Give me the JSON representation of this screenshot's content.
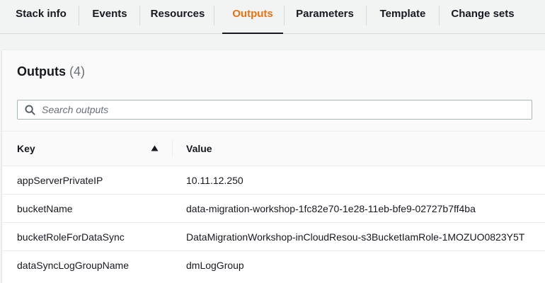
{
  "tabs": [
    {
      "label": "Stack info",
      "active": false
    },
    {
      "label": "Events",
      "active": false
    },
    {
      "label": "Resources",
      "active": false
    },
    {
      "label": "Outputs",
      "active": true
    },
    {
      "label": "Parameters",
      "active": false
    },
    {
      "label": "Template",
      "active": false
    },
    {
      "label": "Change sets",
      "active": false
    }
  ],
  "outputs": {
    "title": "Outputs",
    "count": "(4)",
    "search_placeholder": "Search outputs",
    "columns": {
      "key": "Key",
      "value": "Value"
    },
    "sort_icon": "caret-up-icon",
    "rows": [
      {
        "key": "appServerPrivateIP",
        "value": "10.11.12.250"
      },
      {
        "key": "bucketName",
        "value": "data-migration-workshop-1fc82e70-1e28-11eb-bfe9-02727b7ff4ba"
      },
      {
        "key": "bucketRoleForDataSync",
        "value": "DataMigrationWorkshop-inCloudResou-s3BucketIamRole-1MOZUO0823Y5T"
      },
      {
        "key": "dataSyncLogGroupName",
        "value": "dmLogGroup"
      }
    ]
  },
  "colors": {
    "accent_active_tab": "#ec7211",
    "text": "#16191f",
    "muted": "#687078",
    "background": "#f2f3f3"
  }
}
